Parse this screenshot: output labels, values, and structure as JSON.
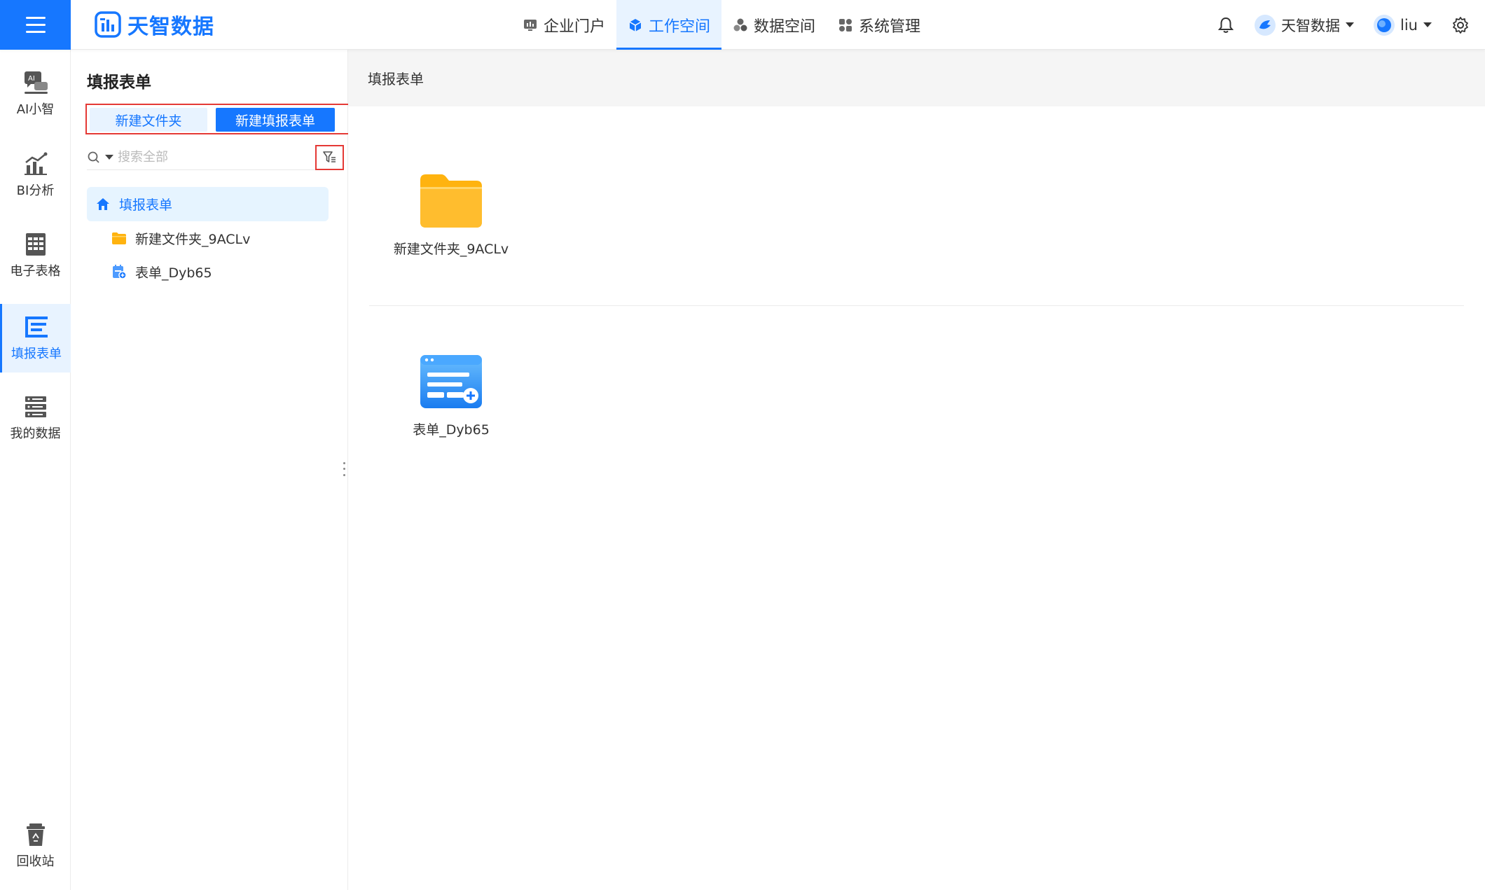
{
  "header": {
    "logo_text": "天智数据",
    "nav": [
      {
        "label": "企业门户",
        "icon": "portal-icon"
      },
      {
        "label": "工作空间",
        "icon": "cube-icon",
        "active": true
      },
      {
        "label": "数据空间",
        "icon": "data-cluster-icon"
      },
      {
        "label": "系统管理",
        "icon": "grid-settings-icon"
      }
    ],
    "org_label": "天智数据",
    "user_label": "liu"
  },
  "rail": {
    "items": [
      {
        "label": "AI小智",
        "icon": "ai-chat-icon"
      },
      {
        "label": "BI分析",
        "icon": "bar-line-chart-icon"
      },
      {
        "label": "电子表格",
        "icon": "spreadsheet-icon"
      },
      {
        "label": "填报表单",
        "icon": "form-list-icon",
        "active": true
      },
      {
        "label": "我的数据",
        "icon": "database-icon"
      }
    ],
    "recycle_label": "回收站"
  },
  "tree_panel": {
    "title": "填报表单",
    "new_folder_label": "新建文件夹",
    "new_form_label": "新建填报表单",
    "search_placeholder": "搜索全部",
    "filter_annotation": "筛选",
    "root_label": "填报表单",
    "nodes": [
      {
        "label": "新建文件夹_9ACLv",
        "type": "folder"
      },
      {
        "label": "表单_Dyb65",
        "type": "form"
      }
    ]
  },
  "main": {
    "breadcrumb": "填报表单",
    "items": [
      {
        "label": "新建文件夹_9ACLv",
        "type": "folder"
      },
      {
        "label": "表单_Dyb65",
        "type": "form"
      }
    ]
  },
  "colors": {
    "brand": "#1677ff",
    "annotation_red": "#e53935",
    "folder_yellow": "#ffb30f"
  }
}
